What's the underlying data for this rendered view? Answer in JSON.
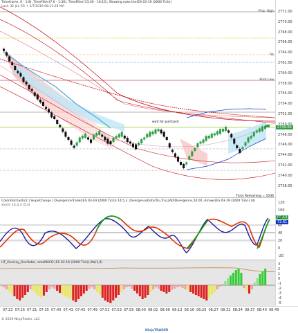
{
  "price_pane": {
    "title": "Timeframe, 0 - 1:8), TimeFilter(7.0 - 1:30), TimeFilter(13:30 - 16:15), Showing rows the(ES 03-19 (2000 Tick))",
    "subtitle": "Last: 32 |Lt: ES + 3/7/2019 08:11:28 NYI",
    "level_labels": {
      "prior_high": "Prior High",
      "prior_low": "Prior Low",
      "fib": "Fib Levels",
      "fib_short": "Fib"
    },
    "annotation": "wait for pull back",
    "ticks_remaining": "Ticks Remaining = 1036",
    "price_axis": [
      "2772.00",
      "2770.00",
      "2768.00",
      "2766.00",
      "2764.00",
      "2762.00",
      "2760.00",
      "2758.00",
      "2756.00",
      "2754.00",
      "2752.00",
      "2750.00",
      "2748.00",
      "2746.00",
      "2744.00",
      "2742.00",
      "2740.00",
      "2738.00"
    ],
    "current_price": "2749.00",
    "last_bar_marker": "2750.00"
  },
  "osc_pane": {
    "title": "ColorStochastic2 | SlopeChange | DivergenceTrader(ES 03-19 (2000 Tick)) 14,5,3 ,DivergenceDots(Tru,Tru),|ADIDivergence,50.00 ,Arrows(ES 03-19 (2000 Tick)) (4)",
    "subtitle": "stoch: 14,3,3 (5,3)",
    "axis": [
      "120",
      "100",
      "80",
      "60",
      "40",
      "20",
      "0",
      "-20"
    ],
    "tags": [
      "80.13",
      "72.61"
    ]
  },
  "hist_pane": {
    "title": "UT_Overlay_Oscillator, emaMACD (ES 03-19 (2000 Tick)),Ma(1,9)",
    "axis": [
      "3",
      "2",
      "1",
      "0",
      "-1",
      "-2",
      "-3",
      "-4",
      "-5"
    ]
  },
  "time_axis": [
    "07:23",
    "07:26",
    "07:31",
    "07:35",
    "07:40",
    "07:43",
    "07:45",
    "07:49",
    "07:51",
    "07:53",
    "07:59",
    "08:00",
    "08:02",
    "08:06",
    "08:13",
    "08:16",
    "08:20",
    "08:27",
    "08:32",
    "08:34",
    "08:37",
    "08:40",
    "08:49"
  ],
  "copyright": "© 2019 NinjaTrader, LLC",
  "watermark": "NinjaTRADER",
  "colors": {
    "bull": "#2ea043",
    "bear": "#111111",
    "band_red": "#c0000d",
    "blue": "#1436c8",
    "cyan": "#5fb7e0",
    "green": "#18a018",
    "gold": "#d9a400",
    "hist_green": "#33cc33",
    "hist_yellow": "#e8e860",
    "hist_red": "#e02020"
  }
}
